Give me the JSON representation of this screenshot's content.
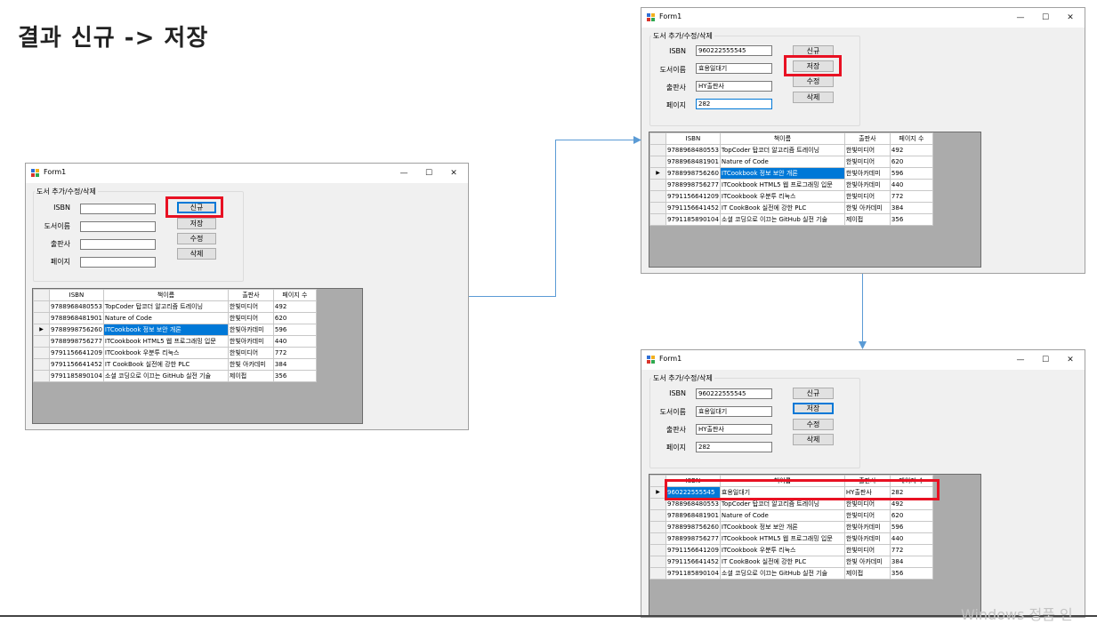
{
  "slide_title": "결과 신규 -> 저장",
  "watermark": "Windows 정품 인",
  "colors": {
    "highlight": "#e81123",
    "connector": "#5b9bd5",
    "selection": "#0078d7"
  },
  "window_controls": {
    "minimize": "—",
    "maximize": "☐",
    "close": "✕"
  },
  "labels": {
    "form_title": "Form1",
    "group_title": "도서 추가/수정/삭제",
    "isbn": "ISBN",
    "book_name": "도서이름",
    "publisher": "출판사",
    "pages": "페이지"
  },
  "buttons": {
    "new": "신규",
    "save": "저장",
    "edit": "수정",
    "delete": "삭제"
  },
  "grid_headers": [
    "ISBN",
    "책이름",
    "출판사",
    "페이지 수"
  ],
  "rows": [
    [
      "9788968480553",
      "TopCoder 탑코더 알고리즘 트레이닝",
      "한빛미디어",
      "492"
    ],
    [
      "9788968481901",
      "Nature of Code",
      "한빛미디어",
      "620"
    ],
    [
      "9788998756260",
      "ITCookbook 정보 보안 개론",
      "한빛아카데미",
      "596"
    ],
    [
      "9788998756277",
      "ITCookbook HTML5 웹 프로그래밍 입문",
      "한빛아카데미",
      "440"
    ],
    [
      "9791156641209",
      "ITCookbook 우분투 리눅스",
      "한빛미디어",
      "772"
    ],
    [
      "9791156641452",
      "IT CookBook 실전에 강한 PLC",
      "한빛 아카데미",
      "384"
    ],
    [
      "9791185890104",
      "소셜 코딩으로 이끄는 GitHub 실전 기술",
      "제이펍",
      "356"
    ]
  ],
  "window1": {
    "isbn_value": "",
    "book_name_value": "",
    "publisher_value": "",
    "pages_value": "",
    "selected_row": 2
  },
  "window2": {
    "isbn_value": "960222555545",
    "book_name_value": "효용일대기",
    "publisher_value": "HY출판사",
    "pages_value": "282",
    "selected_row": 2
  },
  "window3": {
    "isbn_value": "960222555545",
    "book_name_value": "효용일대기",
    "publisher_value": "HY출판사",
    "pages_value": "282",
    "new_row": [
      "960222555545",
      "효용일대기",
      "HY출판사",
      "282"
    ]
  }
}
